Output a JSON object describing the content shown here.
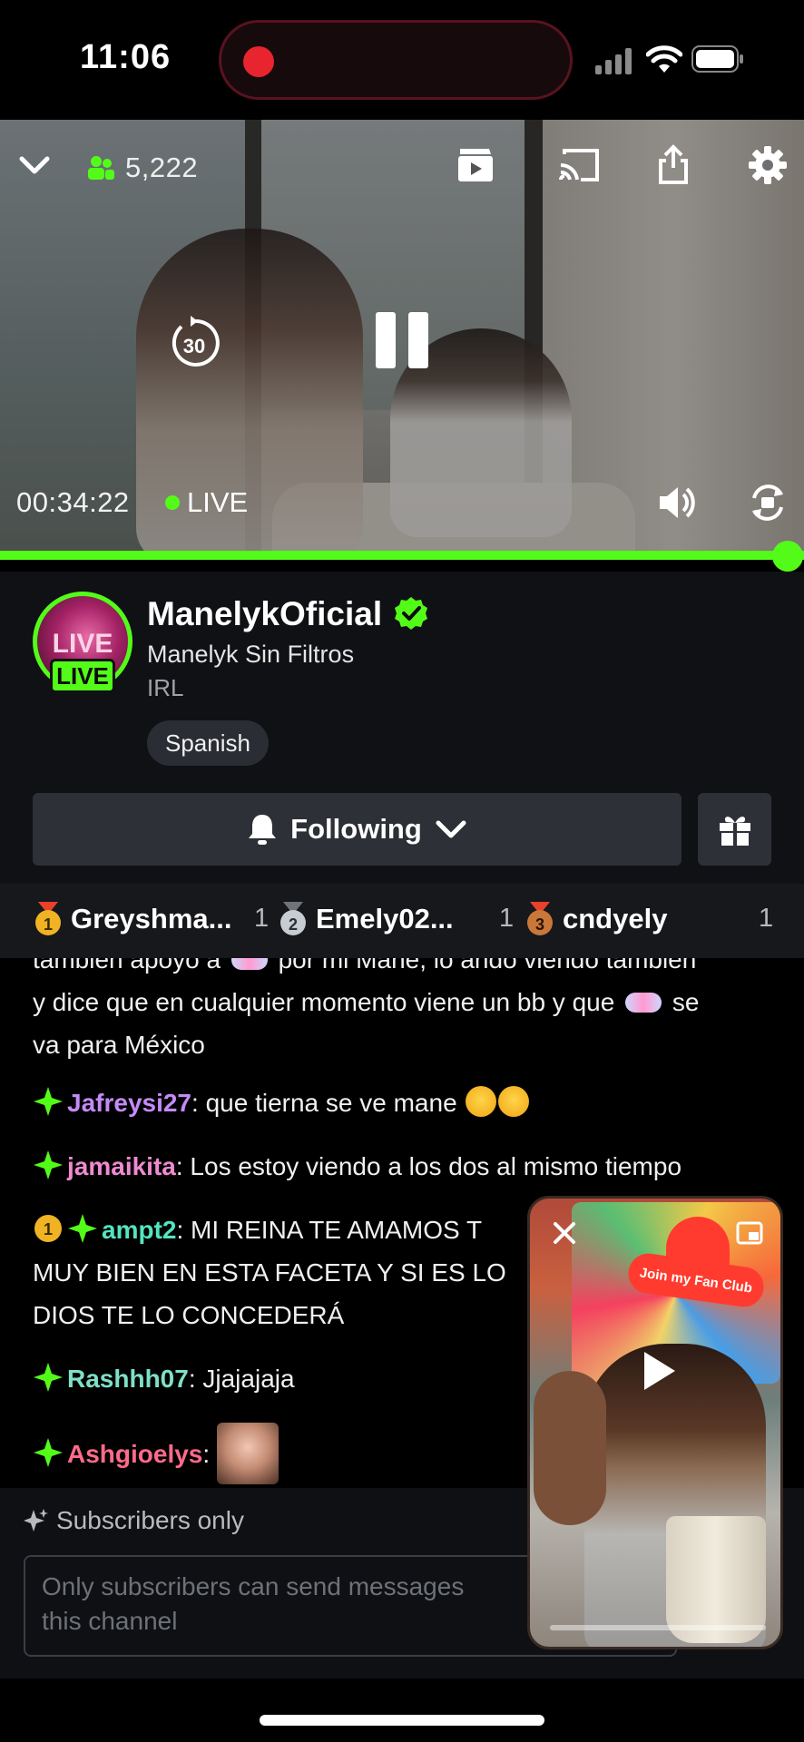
{
  "status": {
    "time": "11:06"
  },
  "player": {
    "viewers": "5,222",
    "elapsed": "00:34:22",
    "live_label": "LIVE",
    "rewind_seconds": "30",
    "progress": 1.0
  },
  "channel": {
    "name": "ManelykOficial",
    "stream_title": "Manelyk Sin Filtros",
    "category": "IRL",
    "language_tag": "Spanish",
    "avatar_live_badge": "LIVE",
    "follow_label": "Following",
    "avatar_text": "LIVE"
  },
  "leaderboard": [
    {
      "rank": "1",
      "user": "Greyshma...",
      "count": "1"
    },
    {
      "rank": "2",
      "user": "Emely02...",
      "count": "1"
    },
    {
      "rank": "3",
      "user": "cndyely",
      "count": "1"
    }
  ],
  "chat": {
    "partial_line_1": "también apoyo a",
    "partial_line_1b": "por mi Mane, lo ando viendo también",
    "partial_line_2a": "y dice que en cualquier momento viene un bb y que",
    "partial_line_2b": "se",
    "partial_line_3": "va para México",
    "messages": [
      {
        "user": "Jafreysi27",
        "text": ": que tierna se ve mane",
        "color": "#c58af9"
      },
      {
        "user": "jamaikita",
        "text": ": Los estoy viendo a los dos al mismo tiempo",
        "color": "#f08ad0"
      },
      {
        "user": "ampt2",
        "text_1": ": MI REINA TE AMAMOS T",
        "text_2": "MUY BIEN EN ESTA FACETA Y SI ES LO",
        "text_3": "DIOS TE LO CONCEDERÁ",
        "color": "#53e5c0",
        "badge": "1"
      },
      {
        "user": "Rashhh07",
        "text": ": Jjajajaja",
        "color": "#7fe0c6"
      },
      {
        "user": "Ashgioelys",
        "text": ":",
        "color": "#ff6b8a"
      }
    ]
  },
  "compose": {
    "subscribers_only": "Subscribers only",
    "placeholder_1": "Only subscribers can send messages",
    "placeholder_2": "this channel"
  },
  "pip": {
    "fan_club": "Join my Fan Club"
  },
  "colors": {
    "accent": "#53fc18"
  }
}
